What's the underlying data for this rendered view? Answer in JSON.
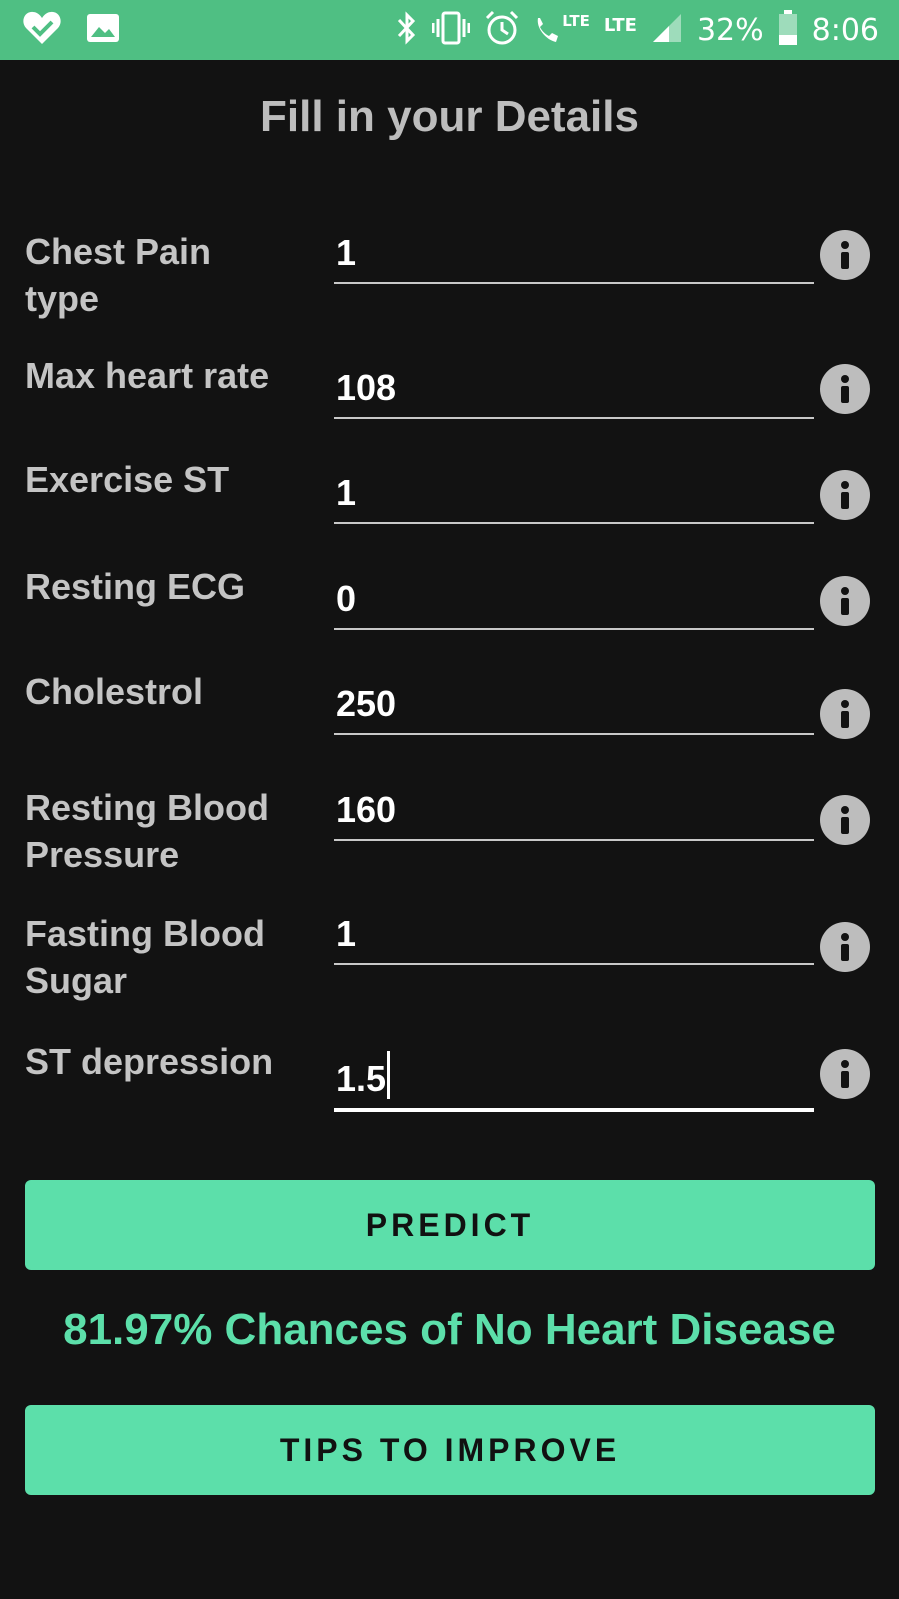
{
  "status_bar": {
    "battery_percent": "32%",
    "time": "8:06",
    "net_1": "LTE",
    "net_2": "LTE",
    "icons": [
      "heart-check-icon",
      "image-icon",
      "bluetooth-icon",
      "vibrate-icon",
      "alarm-icon",
      "volte-call-icon",
      "signal-icon",
      "battery-icon"
    ]
  },
  "page": {
    "title": "Fill in your Details"
  },
  "fields": [
    {
      "label": "Chest Pain type",
      "value": "1"
    },
    {
      "label": "Max heart rate",
      "value": "108"
    },
    {
      "label": "Exercise ST",
      "value": "1"
    },
    {
      "label": "Resting ECG",
      "value": "0"
    },
    {
      "label": "Cholestrol",
      "value": "250"
    },
    {
      "label": "Resting Blood Pressure",
      "value": "160"
    },
    {
      "label": "Fasting Blood Sugar",
      "value": "1"
    },
    {
      "label": "ST depression",
      "value": "1.5"
    }
  ],
  "predict_button": {
    "label": "PREDICT"
  },
  "result_text": "81.97% Chances of No Heart Disease",
  "tips_button": {
    "label": "TIPS TO IMPROVE"
  },
  "colors": {
    "status_bar": "#4fbf83",
    "background": "#121212",
    "accent": "#5cdfaa",
    "label": "#c4c4c4",
    "info_icon": "#bdbdbd"
  }
}
